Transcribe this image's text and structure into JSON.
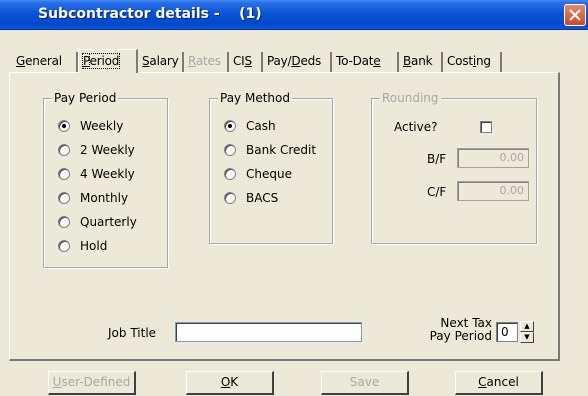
{
  "window": {
    "title": "Subcontractor details -    (1)"
  },
  "tabs": [
    {
      "label": "General",
      "underline": "G",
      "rest": "eneral",
      "state": "normal"
    },
    {
      "label": "Period",
      "underline": "P",
      "rest": "eriod",
      "state": "active"
    },
    {
      "label": "Salary",
      "underline": "S",
      "rest": "alary",
      "state": "normal"
    },
    {
      "label": "Rates",
      "underline": "R",
      "rest": "ates",
      "state": "disabled"
    },
    {
      "label": "CIS",
      "pre": "CI",
      "underline": "S",
      "rest": "",
      "state": "normal"
    },
    {
      "label": "Pay/Deds",
      "pre": "Pay/",
      "underline": "D",
      "rest": "eds",
      "state": "normal"
    },
    {
      "label": "To-Date",
      "pre": "To-Dat",
      "underline": "e",
      "rest": "",
      "state": "normal"
    },
    {
      "label": "Bank",
      "underline": "B",
      "rest": "ank",
      "state": "normal"
    },
    {
      "label": "Costing",
      "pre": "Cost",
      "underline": "i",
      "rest": "ng",
      "state": "normal"
    }
  ],
  "pay_period": {
    "legend": "Pay Period",
    "selected": "Weekly",
    "options": [
      "Weekly",
      "2 Weekly",
      "4 Weekly",
      "Monthly",
      "Quarterly",
      "Hold"
    ]
  },
  "pay_method": {
    "legend": "Pay Method",
    "selected": "Cash",
    "options": [
      "Cash",
      "Bank Credit",
      "Cheque",
      "BACS"
    ]
  },
  "rounding": {
    "legend": "Rounding",
    "active_label": "Active?",
    "active_checked": false,
    "bf_label": "B/F",
    "bf_value": "0.00",
    "cf_label": "C/F",
    "cf_value": "0.00"
  },
  "job_title": {
    "label": "Job Title",
    "value": ""
  },
  "next_tax": {
    "label_line1": "Next Tax",
    "label_line2": "Pay Period",
    "value": "0"
  },
  "buttons": {
    "user_defined": {
      "label": "User-Defined",
      "underline": "U",
      "rest": "ser-Defined",
      "enabled": false
    },
    "ok": {
      "label": "OK",
      "underline": "O",
      "rest": "K",
      "enabled": true
    },
    "save": {
      "label": "Save",
      "enabled": false
    },
    "cancel": {
      "label": "Cancel",
      "underline": "C",
      "rest": "ancel",
      "enabled": true
    }
  }
}
